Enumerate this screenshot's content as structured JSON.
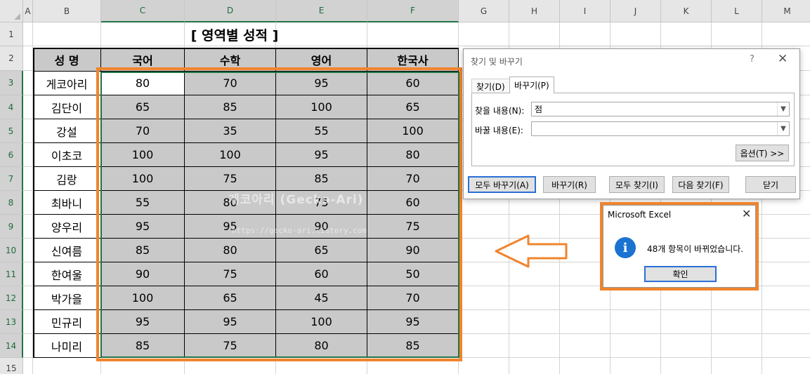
{
  "columns": [
    "A",
    "B",
    "C",
    "D",
    "E",
    "F",
    "G",
    "H",
    "I",
    "J",
    "K",
    "L",
    "M"
  ],
  "rows": [
    "1",
    "2",
    "3",
    "4",
    "5",
    "6",
    "7",
    "8",
    "9",
    "10",
    "11",
    "12",
    "13",
    "14",
    "15"
  ],
  "sheet": {
    "title": "[ 영역별 성적 ]",
    "headers": [
      "성 명",
      "국어",
      "수학",
      "영어",
      "한국사"
    ],
    "records": [
      {
        "name": "게코아리",
        "scores": [
          "80",
          "70",
          "95",
          "60"
        ]
      },
      {
        "name": "김단이",
        "scores": [
          "65",
          "85",
          "100",
          "65"
        ]
      },
      {
        "name": "강설",
        "scores": [
          "70",
          "35",
          "55",
          "100"
        ]
      },
      {
        "name": "이초코",
        "scores": [
          "100",
          "100",
          "95",
          "80"
        ]
      },
      {
        "name": "김랑",
        "scores": [
          "100",
          "75",
          "85",
          "70"
        ]
      },
      {
        "name": "최바니",
        "scores": [
          "55",
          "80",
          "75",
          "60"
        ]
      },
      {
        "name": "양우리",
        "scores": [
          "95",
          "95",
          "90",
          "75"
        ]
      },
      {
        "name": "신여름",
        "scores": [
          "85",
          "80",
          "65",
          "90"
        ]
      },
      {
        "name": "한여울",
        "scores": [
          "90",
          "75",
          "60",
          "50"
        ]
      },
      {
        "name": "박가을",
        "scores": [
          "100",
          "65",
          "45",
          "70"
        ]
      },
      {
        "name": "민규리",
        "scores": [
          "95",
          "95",
          "100",
          "95"
        ]
      },
      {
        "name": "나미리",
        "scores": [
          "85",
          "75",
          "80",
          "85"
        ]
      }
    ],
    "watermark": "게코아리 (Gecko-Ari)",
    "watermark_url": "https://gecko-ari.tistory.com"
  },
  "find_replace": {
    "title": "찾기 및 바꾸기",
    "help": "?",
    "close": "✕",
    "tab_find": "찾기(D)",
    "tab_replace": "바꾸기(P)",
    "find_label": "찾을 내용(N):",
    "find_value": "점",
    "replace_label": "바꿀 내용(E):",
    "replace_value": "",
    "options_button": "옵션(T) >>",
    "replace_all_button": "모두 바꾸기(A)",
    "replace_button": "바꾸기(R)",
    "find_all_button": "모두 찾기(I)",
    "find_next_button": "다음 찾기(F)",
    "close_button": "닫기"
  },
  "message_box": {
    "title": "Microsoft Excel",
    "close": "✕",
    "message": "48개 항목이 바뀌었습니다.",
    "ok_button": "확인"
  },
  "colors": {
    "accent": "#f0842e",
    "excel_green": "#217346",
    "cell_gray": "#c9c9c9",
    "info_blue": "#1b73d1"
  }
}
